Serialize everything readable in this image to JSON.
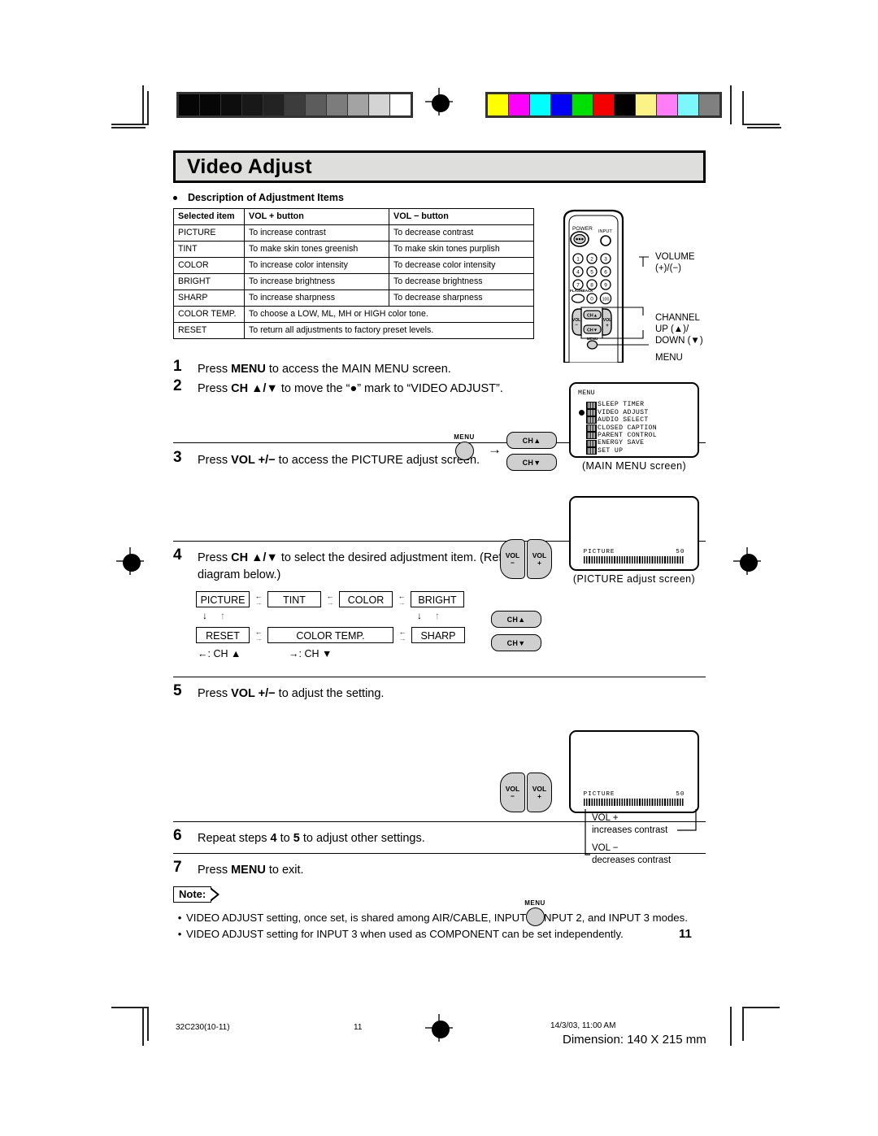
{
  "header": {
    "title": "Video Adjust",
    "section_label": "Description of Adjustment Items"
  },
  "table": {
    "columns": [
      "Selected item",
      "VOL + button",
      "VOL − button"
    ],
    "rows": [
      {
        "item": "PICTURE",
        "plus": "To increase contrast",
        "minus": "To decrease contrast",
        "span": false
      },
      {
        "item": "TINT",
        "plus": "To make skin tones greenish",
        "minus": "To make skin tones purplish",
        "span": false
      },
      {
        "item": "COLOR",
        "plus": "To increase color intensity",
        "minus": "To decrease color intensity",
        "span": false
      },
      {
        "item": "BRIGHT",
        "plus": "To increase brightness",
        "minus": "To decrease brightness",
        "span": false
      },
      {
        "item": "SHARP",
        "plus": "To increase sharpness",
        "minus": "To decrease sharpness",
        "span": false
      },
      {
        "item": "COLOR TEMP.",
        "plus": "To choose a LOW, ML, MH or HIGH color tone.",
        "minus": "",
        "span": true
      },
      {
        "item": "RESET",
        "plus": "To return all adjustments to factory preset levels.",
        "minus": "",
        "span": true
      }
    ]
  },
  "remote": {
    "power_label": "POWER",
    "input_label": "INPUT",
    "flashback_label": "FLASHBACK",
    "keys": [
      "1",
      "2",
      "3",
      "4",
      "5",
      "6",
      "7",
      "8",
      "9",
      "0",
      "100"
    ],
    "vol_minus": "VOL",
    "vol_minus_sign": "−",
    "vol_plus": "VOL",
    "vol_plus_sign": "+",
    "ch_up": "CH▲",
    "ch_down": "CH▼",
    "menu": "MENU",
    "callouts": {
      "volume": "VOLUME",
      "volume_sub": "(+)/(−)",
      "channel": "CHANNEL",
      "channel_up": "UP (▲)/",
      "channel_down": "DOWN (▼)",
      "menu": "MENU"
    }
  },
  "steps": [
    {
      "num": "1",
      "text_parts": [
        "Press ",
        "MENU",
        " to access the MAIN MENU screen."
      ]
    },
    {
      "num": "2",
      "text_parts": [
        "Press ",
        "CH ▲/▼",
        " to move the “●” mark to “VIDEO ADJUST”."
      ]
    },
    {
      "num": "3",
      "text_parts": [
        "Press ",
        "VOL +/−",
        " to access the PICTURE adjust screen."
      ]
    },
    {
      "num": "4",
      "text_parts": [
        "Press ",
        "CH ▲/▼",
        " to select the desired adjustment item. (Refer to the diagram below.)"
      ]
    },
    {
      "num": "5",
      "text_parts": [
        "Press ",
        "VOL +/−",
        " to adjust the setting."
      ]
    },
    {
      "num": "6",
      "text_parts": [
        "Repeat steps ",
        "4",
        " to ",
        "5",
        " to adjust other settings."
      ]
    },
    {
      "num": "7",
      "text_parts": [
        "Press ",
        "MENU",
        " to exit."
      ]
    }
  ],
  "main_menu_screen": {
    "header": "MENU",
    "items": [
      "SLEEP TIMER",
      "VIDEO ADJUST",
      "AUDIO SELECT",
      "CLOSED CAPTION",
      "PARENT CONTROL",
      "ENERGY SAVE",
      "SET UP"
    ],
    "selected_index": 1,
    "caption": "(MAIN MENU screen)"
  },
  "picture_screen": {
    "label": "PICTURE",
    "value": "50",
    "caption": "(PICTURE adjust screen)"
  },
  "picture_screen_step5": {
    "label": "PICTURE",
    "value": "50",
    "callout_plus_line1": "VOL +",
    "callout_plus_line2": "increases contrast",
    "callout_minus_line1": "VOL −",
    "callout_minus_line2": "decreases contrast"
  },
  "flow": {
    "row1": [
      "PICTURE",
      "TINT",
      "COLOR",
      "BRIGHT"
    ],
    "row2": [
      "RESET",
      "COLOR TEMP.",
      "SHARP"
    ],
    "legend_left": "←: CH ▲",
    "legend_right": "→: CH ▼",
    "ch_up_button": "CH▲",
    "ch_down_button": "CH▼"
  },
  "note": {
    "label": "Note:",
    "bullets": [
      "VIDEO ADJUST setting, once set, is shared among AIR/CABLE, INPUT 1, INPUT 2, and INPUT 3 modes.",
      "VIDEO ADJUST setting for INPUT 3 when used as COMPONENT can be set independently."
    ],
    "page_number_inline": "11"
  },
  "footer": {
    "doc_code": "32C230(10-11)",
    "page": "11",
    "timestamp": "14/3/03, 11:00 AM",
    "dimension": "Dimension: 140  X 215 mm"
  },
  "colors": {
    "title_bg": "#dededc",
    "button_face": "#cfcfcf",
    "grayscale_bar": [
      "#050505",
      "#060606",
      "#0d0d0d",
      "#181818",
      "#232323",
      "#3c3c3c",
      "#5c5c5c",
      "#7c7c7c",
      "#a3a3a3",
      "#d4d4d4",
      "#ffffff"
    ],
    "color_bar": [
      "#ffff00",
      "#ff00ff",
      "#00ffff",
      "#0000f5",
      "#00e000",
      "#f50000",
      "#000000",
      "#fcf387",
      "#ff7ef7",
      "#7cf7fb",
      "#808080"
    ]
  }
}
